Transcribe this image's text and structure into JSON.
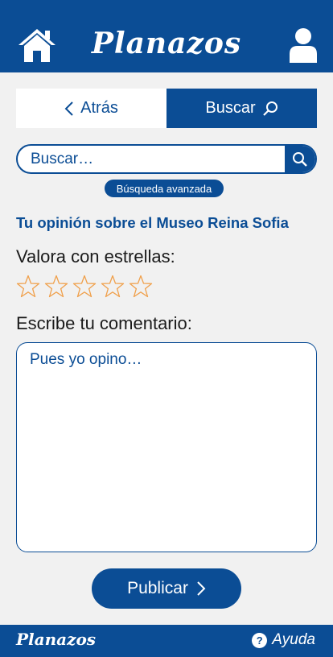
{
  "header": {
    "brand": "Planazos",
    "home_icon": "home-icon",
    "user_icon": "user-icon"
  },
  "nav": {
    "back_label": "Atrás",
    "search_label": "Buscar"
  },
  "search": {
    "placeholder": "Buscar…",
    "advanced_label": "Búsqueda avanzada"
  },
  "review": {
    "title": "Tu opinión sobre el Museo Reina Sofia",
    "rate_label": "Valora con estrellas:",
    "stars_total": 5,
    "stars_selected": 0,
    "comment_label": "Escribe tu comentario:",
    "comment_placeholder": "Pues yo opino…"
  },
  "actions": {
    "publish_label": "Publicar"
  },
  "footer": {
    "brand": "Planazos",
    "help_label": "Ayuda",
    "help_glyph": "?"
  },
  "colors": {
    "primary": "#0b4d95",
    "background": "#f1f1f1",
    "star": "#f0a04b"
  }
}
